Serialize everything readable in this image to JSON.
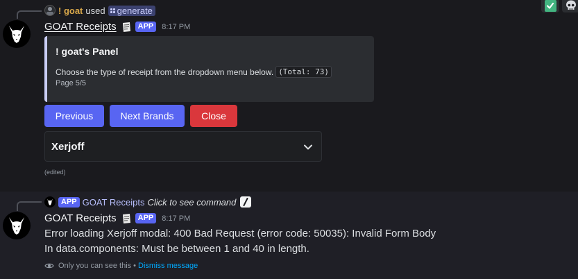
{
  "message1": {
    "reference": {
      "user": "! goat",
      "verb": "used",
      "command": "generate"
    },
    "author": {
      "name": "GOAT Receipts",
      "tag": "APP",
      "timestamp": "8:17 PM"
    },
    "embed": {
      "title": "! goat's Panel",
      "description": "Choose the type of receipt from the dropdown menu below.",
      "code": "(Total: 73)",
      "footer": "Page 5/5",
      "accent_color": "#c9cdf5"
    },
    "buttons": [
      {
        "label": "Previous",
        "color": "#5865f2"
      },
      {
        "label": "Next Brands",
        "color": "#5865f2"
      },
      {
        "label": "Close",
        "color": "#da373c"
      }
    ],
    "select": {
      "value": "Xerjoff"
    },
    "edited_label": "(edited)"
  },
  "message2": {
    "reference": {
      "tag": "APP",
      "bot": "GOAT Receipts",
      "hint": "Click to see command"
    },
    "author": {
      "name": "GOAT Receipts",
      "tag": "APP",
      "timestamp": "8:17 PM"
    },
    "error_lines": [
      "Error loading Xerjoff modal: 400 Bad Request (error code: 50035): Invalid Form Body",
      "In data.components: Must be between 1 and 40 in length."
    ],
    "ephemeral": {
      "notice": "Only you can see this",
      "separator": "•",
      "dismiss": "Dismiss message"
    }
  },
  "reactions": [
    {
      "icon": "check-mark-icon"
    },
    {
      "icon": "skull-icon"
    }
  ],
  "colors": {
    "blurple": "#5865f2",
    "danger": "#da373c",
    "link": "#00a8fc",
    "username": "#d9a84a"
  }
}
